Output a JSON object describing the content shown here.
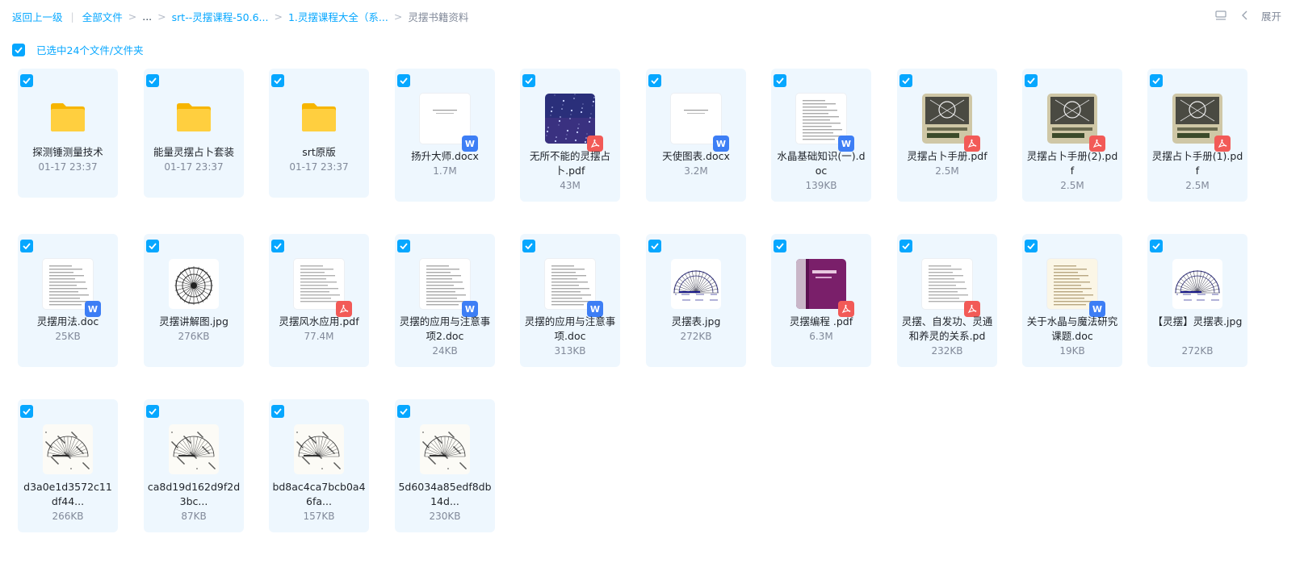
{
  "breadcrumb": {
    "back": "返回上一级",
    "all_files": "全部文件",
    "ellipsis": "...",
    "level1": "srt--灵摆课程-50.6...",
    "level2": "1.灵摆课程大全（系...",
    "current": "灵摆书籍资料"
  },
  "toolbar": {
    "expand_label": "展开"
  },
  "selection": {
    "text": "已选中24个文件/文件夹"
  },
  "colors": {
    "accent": "#06a7ff",
    "word": "#3d7ef5",
    "pdf": "#f25a57",
    "folder": "#ffc93c",
    "card_bg": "#eef7fe"
  },
  "files": [
    {
      "name": "探测锤测量技术",
      "meta": "01-17 23:37",
      "kind": "folder"
    },
    {
      "name": "能量灵摆占卜套装",
      "meta": "01-17 23:37",
      "kind": "folder"
    },
    {
      "name": "srt原版",
      "meta": "01-17 23:37",
      "kind": "folder"
    },
    {
      "name": "扬升大师.docx",
      "meta": "1.7M",
      "kind": "word"
    },
    {
      "name": "无所不能的灵摆占卜.pdf",
      "meta": "43M",
      "kind": "pdf-stars"
    },
    {
      "name": "天使图表.docx",
      "meta": "3.2M",
      "kind": "word"
    },
    {
      "name": "水晶基础知识(一).doc",
      "meta": "139KB",
      "kind": "word-text"
    },
    {
      "name": "灵摆占卜手册.pdf",
      "meta": "2.5M",
      "kind": "pdf-book"
    },
    {
      "name": "灵摆占卜手册(2).pdf",
      "meta": "2.5M",
      "kind": "pdf-book"
    },
    {
      "name": "灵摆占卜手册(1).pdf",
      "meta": "2.5M",
      "kind": "pdf-book"
    },
    {
      "name": "灵摆用法.doc",
      "meta": "25KB",
      "kind": "word-text"
    },
    {
      "name": "灵摆讲解图.jpg",
      "meta": "276KB",
      "kind": "image-chart"
    },
    {
      "name": "灵摆风水应用.pdf",
      "meta": "77.4M",
      "kind": "pdf-text"
    },
    {
      "name": "灵摆的应用与注意事项2.doc",
      "meta": "24KB",
      "kind": "word-text"
    },
    {
      "name": "灵摆的应用与注意事项.doc",
      "meta": "313KB",
      "kind": "word-text"
    },
    {
      "name": "灵摆表.jpg",
      "meta": "272KB",
      "kind": "image-chart2"
    },
    {
      "name": "灵摆编程 .pdf",
      "meta": "6.3M",
      "kind": "pdf-purple"
    },
    {
      "name": "灵摆、自发功、灵通和养灵的关系.pd",
      "meta": "232KB",
      "kind": "pdf-text"
    },
    {
      "name": "关于水晶与魔法研究课题.doc",
      "meta": "19KB",
      "kind": "word-aged"
    },
    {
      "name": "【灵摆】灵摆表.jpg",
      "meta": "272KB",
      "kind": "image-chart2"
    },
    {
      "name": "d3a0e1d3572c11df44...",
      "meta": "266KB",
      "kind": "image-chart3"
    },
    {
      "name": "ca8d19d162d9f2d3bc...",
      "meta": "87KB",
      "kind": "image-chart3"
    },
    {
      "name": "bd8ac4ca7bcb0a46fa...",
      "meta": "157KB",
      "kind": "image-chart3"
    },
    {
      "name": "5d6034a85edf8db14d...",
      "meta": "230KB",
      "kind": "image-chart3"
    }
  ]
}
